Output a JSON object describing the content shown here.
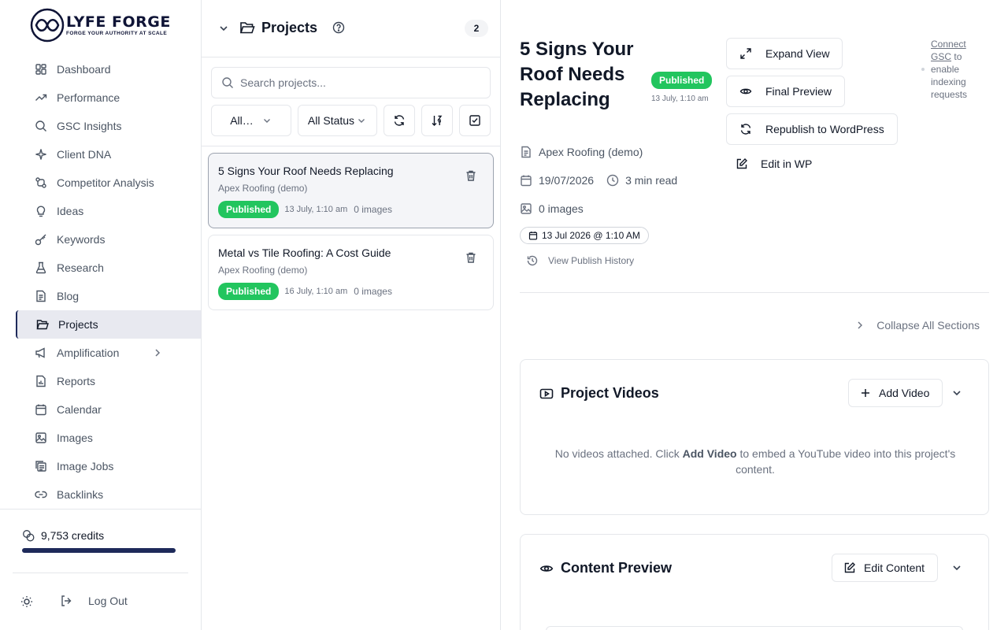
{
  "brand": {
    "name": "LYFE FORGE",
    "tagline": "FORGE YOUR AUTHORITY AT SCALE"
  },
  "sidebar": {
    "items": [
      {
        "label": "Dashboard",
        "icon": "dashboard-icon"
      },
      {
        "label": "Performance",
        "icon": "trending-up-icon"
      },
      {
        "label": "GSC Insights",
        "icon": "search-icon"
      },
      {
        "label": "Client DNA",
        "icon": "sparkle-icon"
      },
      {
        "label": "Competitor Analysis",
        "icon": "git-compare-icon"
      },
      {
        "label": "Ideas",
        "icon": "lightbulb-icon"
      },
      {
        "label": "Keywords",
        "icon": "key-icon"
      },
      {
        "label": "Research",
        "icon": "flask-icon"
      },
      {
        "label": "Blog",
        "icon": "file-text-icon"
      },
      {
        "label": "Projects",
        "icon": "folder-open-icon",
        "active": true
      },
      {
        "label": "Amplification",
        "icon": "megaphone-icon",
        "has_children": true
      },
      {
        "label": "Reports",
        "icon": "file-chart-icon"
      },
      {
        "label": "Calendar",
        "icon": "calendar-icon"
      },
      {
        "label": "Images",
        "icon": "image-icon"
      },
      {
        "label": "Image Jobs",
        "icon": "image-stack-icon"
      },
      {
        "label": "Backlinks",
        "icon": "link-icon"
      }
    ],
    "credits": {
      "label": "9,753 credits",
      "fill_percent": 100
    },
    "logout_label": "Log Out"
  },
  "projects_panel": {
    "title": "Projects",
    "count": "2",
    "search_placeholder": "Search projects...",
    "filter_client": "All…",
    "filter_status": "All Status",
    "items": [
      {
        "title": "5 Signs Your Roof Needs Replacing",
        "client": "Apex Roofing (demo)",
        "status": "Published",
        "date": "13 July, 1:10 am",
        "images": "0 images"
      },
      {
        "title": "Metal vs Tile Roofing: A Cost Guide",
        "client": "Apex Roofing (demo)",
        "status": "Published",
        "date": "16 July, 1:10 am",
        "images": "0 images"
      }
    ]
  },
  "detail": {
    "title": "5 Signs Your Roof Needs Replacing",
    "status": "Published",
    "status_date": "13 July, 1:10 am",
    "client": "Apex Roofing (demo)",
    "date": "19/07/2026",
    "read_time": "3 min read",
    "images": "0 images",
    "schedule": "13 Jul 2026 @ 1:10 AM",
    "history_label": "View Publish History",
    "actions": {
      "expand": "Expand View",
      "final_preview": "Final Preview",
      "republish": "Republish to WordPress",
      "edit_wp": "Edit in WP"
    },
    "gsc": {
      "link": "Connect GSC",
      "text": "to enable indexing requests"
    },
    "collapse_all": "Collapse All Sections",
    "videos": {
      "title": "Project Videos",
      "add_label": "Add Video",
      "empty_before": "No videos attached. Click",
      "empty_bold": "Add Video",
      "empty_after": "to embed a YouTube video into this project's content."
    },
    "content_preview": {
      "title": "Content Preview",
      "edit_label": "Edit Content"
    }
  },
  "colors": {
    "brand_navy": "#1e2a5a",
    "published_green": "#22c55e",
    "active_nav_bg": "#e8e9f0"
  }
}
